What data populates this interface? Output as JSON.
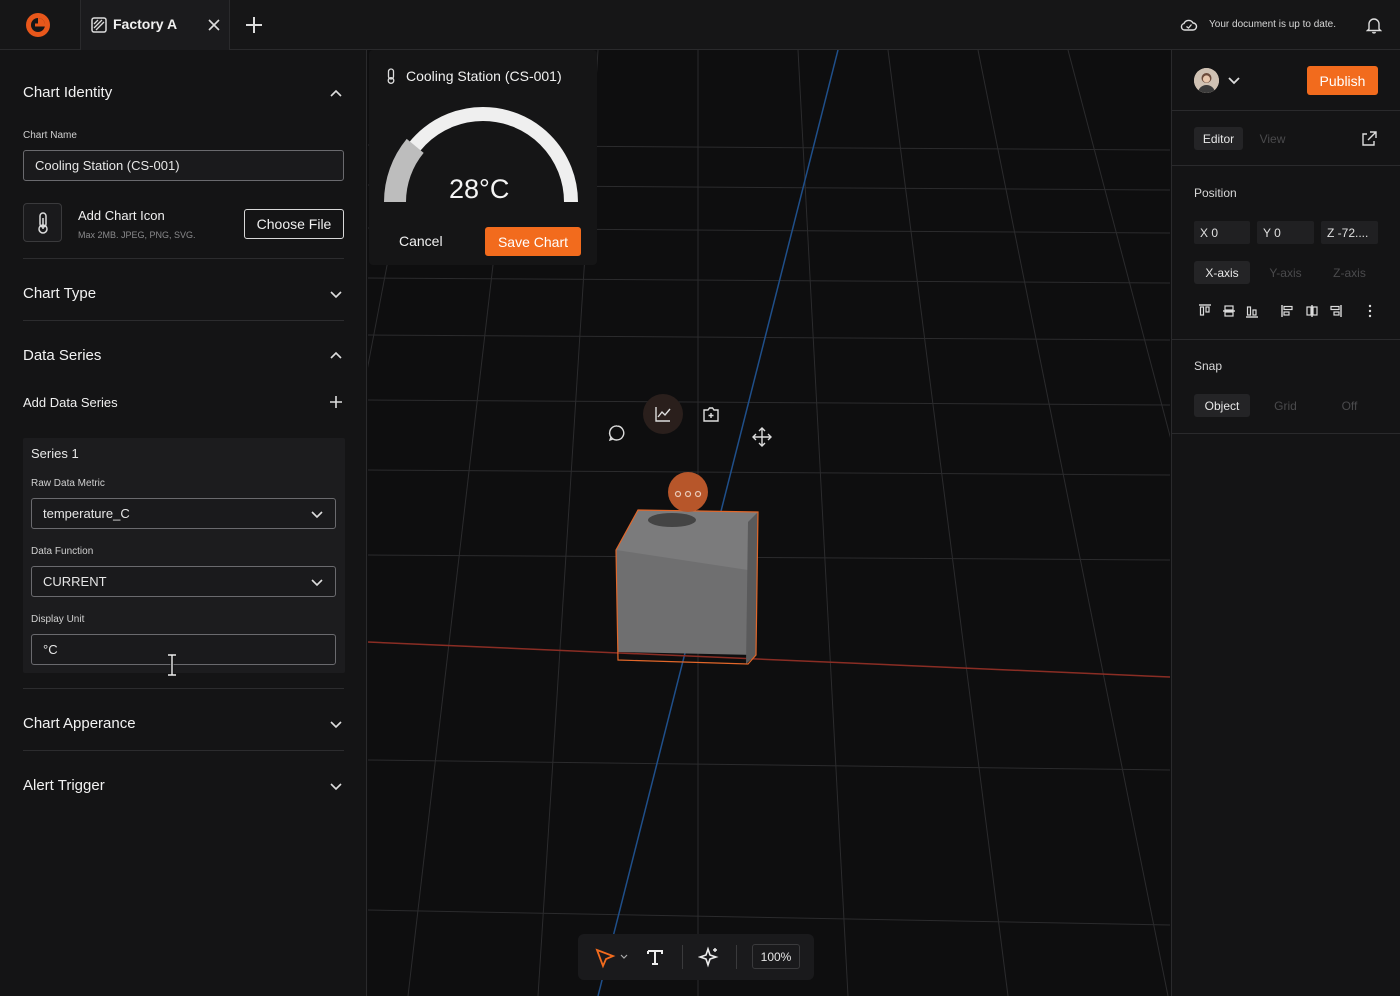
{
  "topbar": {
    "tab_label": "Factory A",
    "doc_status": "Your document is up to date."
  },
  "left_panel": {
    "chart_identity": {
      "title": "Chart Identity",
      "chart_name_label": "Chart Name",
      "chart_name_value": "Cooling Station (CS-001)",
      "add_icon_label": "Add Chart Icon",
      "add_icon_hint": "Max 2MB. JPEG, PNG, SVG.",
      "choose_file": "Choose File"
    },
    "chart_type_title": "Chart Type",
    "data_series": {
      "title": "Data Series",
      "add_label": "Add Data Series",
      "series": {
        "name": "Series 1",
        "raw_metric_label": "Raw Data Metric",
        "raw_metric_value": "temperature_C",
        "function_label": "Data Function",
        "function_value": "CURRENT",
        "unit_label": "Display Unit",
        "unit_value": "°C"
      }
    },
    "appearance_title": "Chart Apperance",
    "alert_title": "Alert Trigger"
  },
  "popup": {
    "title": "Cooling Station (CS-001)",
    "value": "28°C",
    "gauge_fraction": 0.22,
    "cancel": "Cancel",
    "save": "Save Chart"
  },
  "toolbar": {
    "zoom": "100%"
  },
  "right_panel": {
    "publish": "Publish",
    "tabs": [
      "Editor",
      "View"
    ],
    "position_label": "Position",
    "coords": {
      "x": "X 0",
      "y": "Y 0",
      "z": "Z -72...."
    },
    "axes": [
      "X-axis",
      "Y-axis",
      "Z-axis"
    ],
    "snap_label": "Snap",
    "snap_options": [
      "Object",
      "Grid",
      "Off"
    ]
  },
  "colors": {
    "accent": "#f26b1d",
    "panel": "#141415",
    "viewport": "#0e0e0f"
  }
}
